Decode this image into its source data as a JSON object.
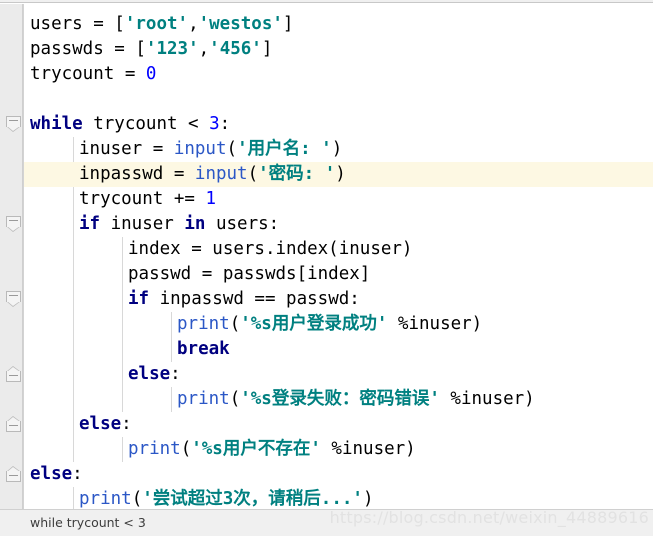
{
  "editor": {
    "language": "python",
    "colors": {
      "keyword": "#000080",
      "string": "#008080",
      "number": "#0000ff",
      "function": "#2b57c6",
      "plain": "#000000",
      "gutter_bg": "#ebebeb",
      "highlight_line_bg": "#fdf8e3",
      "editor_bg": "#ffffff",
      "status_bar_bg": "#f0f0f0"
    },
    "highlighted_line_index": 6,
    "lines": [
      {
        "indent": 0,
        "tokens": [
          {
            "t": "users",
            "c": "plain"
          },
          {
            "t": " = [",
            "c": "plain"
          },
          {
            "t": "'root'",
            "c": "str"
          },
          {
            "t": ",",
            "c": "plain"
          },
          {
            "t": "'westos'",
            "c": "str"
          },
          {
            "t": "]",
            "c": "plain"
          }
        ]
      },
      {
        "indent": 0,
        "tokens": [
          {
            "t": "passwds",
            "c": "plain"
          },
          {
            "t": " = [",
            "c": "plain"
          },
          {
            "t": "'123'",
            "c": "str"
          },
          {
            "t": ",",
            "c": "plain"
          },
          {
            "t": "'456'",
            "c": "str"
          },
          {
            "t": "]",
            "c": "plain"
          }
        ]
      },
      {
        "indent": 0,
        "tokens": [
          {
            "t": "trycount",
            "c": "plain"
          },
          {
            "t": " = ",
            "c": "plain"
          },
          {
            "t": "0",
            "c": "num"
          }
        ]
      },
      {
        "indent": 0,
        "tokens": []
      },
      {
        "indent": 0,
        "tokens": [
          {
            "t": "while",
            "c": "kw"
          },
          {
            "t": " trycount < ",
            "c": "plain"
          },
          {
            "t": "3",
            "c": "num"
          },
          {
            "t": ":",
            "c": "plain"
          }
        ]
      },
      {
        "indent": 1,
        "tokens": [
          {
            "t": "inuser",
            "c": "plain"
          },
          {
            "t": " = ",
            "c": "plain"
          },
          {
            "t": "input",
            "c": "fn"
          },
          {
            "t": "(",
            "c": "plain"
          },
          {
            "t": "'用户名: '",
            "c": "str"
          },
          {
            "t": ")",
            "c": "plain"
          }
        ]
      },
      {
        "indent": 1,
        "tokens": [
          {
            "t": "inpasswd",
            "c": "plain"
          },
          {
            "t": " = ",
            "c": "plain"
          },
          {
            "t": "input",
            "c": "fn"
          },
          {
            "t": "(",
            "c": "plain"
          },
          {
            "t": "'密码: '",
            "c": "str"
          },
          {
            "t": ")",
            "c": "plain"
          }
        ]
      },
      {
        "indent": 1,
        "tokens": [
          {
            "t": "trycount += ",
            "c": "plain"
          },
          {
            "t": "1",
            "c": "num"
          }
        ]
      },
      {
        "indent": 1,
        "tokens": [
          {
            "t": "if",
            "c": "kw"
          },
          {
            "t": " inuser ",
            "c": "plain"
          },
          {
            "t": "in",
            "c": "kw"
          },
          {
            "t": " users:",
            "c": "plain"
          }
        ]
      },
      {
        "indent": 2,
        "tokens": [
          {
            "t": "index = users.index(inuser)",
            "c": "plain"
          }
        ]
      },
      {
        "indent": 2,
        "tokens": [
          {
            "t": "passwd = passwds[index]",
            "c": "plain"
          }
        ]
      },
      {
        "indent": 2,
        "tokens": [
          {
            "t": "if",
            "c": "kw"
          },
          {
            "t": " inpasswd == passwd:",
            "c": "plain"
          }
        ]
      },
      {
        "indent": 3,
        "tokens": [
          {
            "t": "print",
            "c": "fn"
          },
          {
            "t": "(",
            "c": "plain"
          },
          {
            "t": "'%s用户登录成功'",
            "c": "str"
          },
          {
            "t": " %inuser)",
            "c": "plain"
          }
        ]
      },
      {
        "indent": 3,
        "tokens": [
          {
            "t": "break",
            "c": "kw"
          }
        ]
      },
      {
        "indent": 2,
        "tokens": [
          {
            "t": "else",
            "c": "kw"
          },
          {
            "t": ":",
            "c": "plain"
          }
        ]
      },
      {
        "indent": 3,
        "tokens": [
          {
            "t": "print",
            "c": "fn"
          },
          {
            "t": "(",
            "c": "plain"
          },
          {
            "t": "'%s登录失败：密码错误'",
            "c": "str"
          },
          {
            "t": " %inuser)",
            "c": "plain"
          }
        ]
      },
      {
        "indent": 1,
        "tokens": [
          {
            "t": "else",
            "c": "kw"
          },
          {
            "t": ":",
            "c": "plain"
          }
        ]
      },
      {
        "indent": 2,
        "tokens": [
          {
            "t": "print",
            "c": "fn"
          },
          {
            "t": "(",
            "c": "plain"
          },
          {
            "t": "'%s用户不存在'",
            "c": "str"
          },
          {
            "t": " %inuser)",
            "c": "plain"
          }
        ]
      },
      {
        "indent": 0,
        "tokens": [
          {
            "t": "else",
            "c": "kw"
          },
          {
            "t": ":",
            "c": "plain"
          }
        ]
      },
      {
        "indent": 1,
        "tokens": [
          {
            "t": "print",
            "c": "fn"
          },
          {
            "t": "(",
            "c": "plain"
          },
          {
            "t": "'尝试超过3次，请稍后...'",
            "c": "str"
          },
          {
            "t": ")",
            "c": "plain"
          }
        ]
      }
    ],
    "fold_markers": [
      {
        "line": 4,
        "type": "down"
      },
      {
        "line": 8,
        "type": "down"
      },
      {
        "line": 11,
        "type": "down"
      },
      {
        "line": 14,
        "type": "up"
      },
      {
        "line": 16,
        "type": "up"
      },
      {
        "line": 18,
        "type": "up"
      }
    ],
    "indent_guides": [
      {
        "indent": 1,
        "from_line": 5,
        "to_line": 17
      },
      {
        "indent": 2,
        "from_line": 9,
        "to_line": 15
      },
      {
        "indent": 3,
        "from_line": 12,
        "to_line": 13
      },
      {
        "indent": 3,
        "from_line": 15,
        "to_line": 15
      },
      {
        "indent": 2,
        "from_line": 17,
        "to_line": 17
      },
      {
        "indent": 1,
        "from_line": 19,
        "to_line": 19
      }
    ]
  },
  "status_bar": {
    "text": "while trycount < 3"
  },
  "watermark": {
    "text": "https://blog.csdn.net/weixin_44889616"
  }
}
